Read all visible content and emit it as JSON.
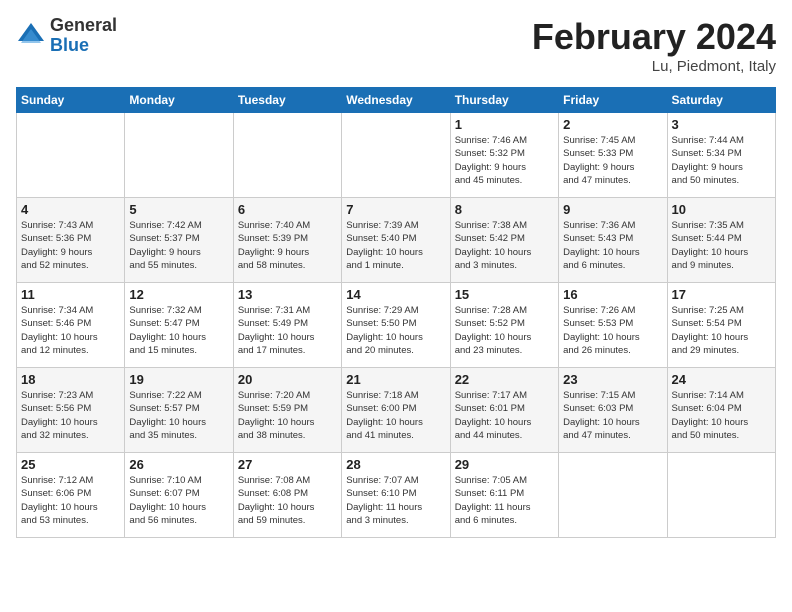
{
  "header": {
    "logo_general": "General",
    "logo_blue": "Blue",
    "title": "February 2024",
    "subtitle": "Lu, Piedmont, Italy"
  },
  "weekdays": [
    "Sunday",
    "Monday",
    "Tuesday",
    "Wednesday",
    "Thursday",
    "Friday",
    "Saturday"
  ],
  "weeks": [
    [
      {
        "day": "",
        "info": ""
      },
      {
        "day": "",
        "info": ""
      },
      {
        "day": "",
        "info": ""
      },
      {
        "day": "",
        "info": ""
      },
      {
        "day": "1",
        "info": "Sunrise: 7:46 AM\nSunset: 5:32 PM\nDaylight: 9 hours\nand 45 minutes."
      },
      {
        "day": "2",
        "info": "Sunrise: 7:45 AM\nSunset: 5:33 PM\nDaylight: 9 hours\nand 47 minutes."
      },
      {
        "day": "3",
        "info": "Sunrise: 7:44 AM\nSunset: 5:34 PM\nDaylight: 9 hours\nand 50 minutes."
      }
    ],
    [
      {
        "day": "4",
        "info": "Sunrise: 7:43 AM\nSunset: 5:36 PM\nDaylight: 9 hours\nand 52 minutes."
      },
      {
        "day": "5",
        "info": "Sunrise: 7:42 AM\nSunset: 5:37 PM\nDaylight: 9 hours\nand 55 minutes."
      },
      {
        "day": "6",
        "info": "Sunrise: 7:40 AM\nSunset: 5:39 PM\nDaylight: 9 hours\nand 58 minutes."
      },
      {
        "day": "7",
        "info": "Sunrise: 7:39 AM\nSunset: 5:40 PM\nDaylight: 10 hours\nand 1 minute."
      },
      {
        "day": "8",
        "info": "Sunrise: 7:38 AM\nSunset: 5:42 PM\nDaylight: 10 hours\nand 3 minutes."
      },
      {
        "day": "9",
        "info": "Sunrise: 7:36 AM\nSunset: 5:43 PM\nDaylight: 10 hours\nand 6 minutes."
      },
      {
        "day": "10",
        "info": "Sunrise: 7:35 AM\nSunset: 5:44 PM\nDaylight: 10 hours\nand 9 minutes."
      }
    ],
    [
      {
        "day": "11",
        "info": "Sunrise: 7:34 AM\nSunset: 5:46 PM\nDaylight: 10 hours\nand 12 minutes."
      },
      {
        "day": "12",
        "info": "Sunrise: 7:32 AM\nSunset: 5:47 PM\nDaylight: 10 hours\nand 15 minutes."
      },
      {
        "day": "13",
        "info": "Sunrise: 7:31 AM\nSunset: 5:49 PM\nDaylight: 10 hours\nand 17 minutes."
      },
      {
        "day": "14",
        "info": "Sunrise: 7:29 AM\nSunset: 5:50 PM\nDaylight: 10 hours\nand 20 minutes."
      },
      {
        "day": "15",
        "info": "Sunrise: 7:28 AM\nSunset: 5:52 PM\nDaylight: 10 hours\nand 23 minutes."
      },
      {
        "day": "16",
        "info": "Sunrise: 7:26 AM\nSunset: 5:53 PM\nDaylight: 10 hours\nand 26 minutes."
      },
      {
        "day": "17",
        "info": "Sunrise: 7:25 AM\nSunset: 5:54 PM\nDaylight: 10 hours\nand 29 minutes."
      }
    ],
    [
      {
        "day": "18",
        "info": "Sunrise: 7:23 AM\nSunset: 5:56 PM\nDaylight: 10 hours\nand 32 minutes."
      },
      {
        "day": "19",
        "info": "Sunrise: 7:22 AM\nSunset: 5:57 PM\nDaylight: 10 hours\nand 35 minutes."
      },
      {
        "day": "20",
        "info": "Sunrise: 7:20 AM\nSunset: 5:59 PM\nDaylight: 10 hours\nand 38 minutes."
      },
      {
        "day": "21",
        "info": "Sunrise: 7:18 AM\nSunset: 6:00 PM\nDaylight: 10 hours\nand 41 minutes."
      },
      {
        "day": "22",
        "info": "Sunrise: 7:17 AM\nSunset: 6:01 PM\nDaylight: 10 hours\nand 44 minutes."
      },
      {
        "day": "23",
        "info": "Sunrise: 7:15 AM\nSunset: 6:03 PM\nDaylight: 10 hours\nand 47 minutes."
      },
      {
        "day": "24",
        "info": "Sunrise: 7:14 AM\nSunset: 6:04 PM\nDaylight: 10 hours\nand 50 minutes."
      }
    ],
    [
      {
        "day": "25",
        "info": "Sunrise: 7:12 AM\nSunset: 6:06 PM\nDaylight: 10 hours\nand 53 minutes."
      },
      {
        "day": "26",
        "info": "Sunrise: 7:10 AM\nSunset: 6:07 PM\nDaylight: 10 hours\nand 56 minutes."
      },
      {
        "day": "27",
        "info": "Sunrise: 7:08 AM\nSunset: 6:08 PM\nDaylight: 10 hours\nand 59 minutes."
      },
      {
        "day": "28",
        "info": "Sunrise: 7:07 AM\nSunset: 6:10 PM\nDaylight: 11 hours\nand 3 minutes."
      },
      {
        "day": "29",
        "info": "Sunrise: 7:05 AM\nSunset: 6:11 PM\nDaylight: 11 hours\nand 6 minutes."
      },
      {
        "day": "",
        "info": ""
      },
      {
        "day": "",
        "info": ""
      }
    ]
  ]
}
